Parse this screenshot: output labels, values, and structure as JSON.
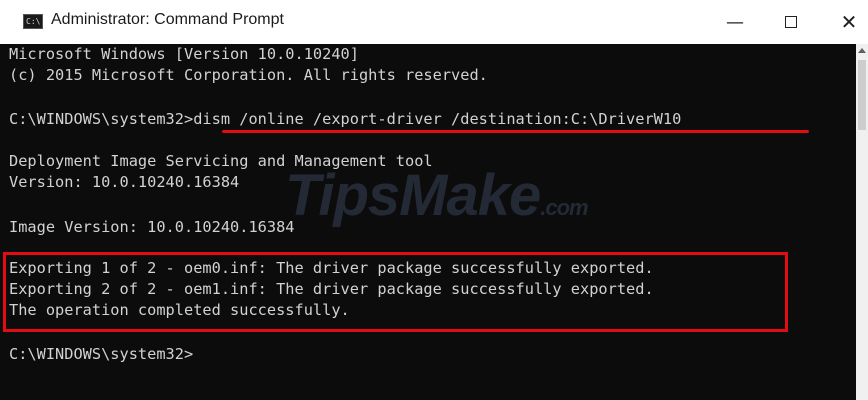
{
  "window": {
    "title": "Administrator: Command Prompt",
    "icon_label": "C:\\",
    "controls": {
      "minimize": "—",
      "close": "✕"
    }
  },
  "console": {
    "lines": [
      "Microsoft Windows [Version 10.0.10240]",
      "(c) 2015 Microsoft Corporation. All rights reserved.",
      "C:\\WINDOWS\\system32>dism /online /export-driver /destination:C:\\DriverW10",
      "Deployment Image Servicing and Management tool",
      "Version: 10.0.10240.16384",
      "Image Version: 10.0.10240.16384",
      "Exporting 1 of 2 - oem0.inf: The driver package successfully exported.",
      "Exporting 2 of 2 - oem1.inf: The driver package successfully exported.",
      "The operation completed successfully.",
      "C:\\WINDOWS\\system32>"
    ],
    "text_color": "#d2d2d2",
    "background_color": "#0c0c0c",
    "annotation_color": "#e10d12"
  },
  "watermark": {
    "text": "TipsMake",
    "suffix": ".com"
  },
  "icons": {
    "app": "cmd-icon",
    "minimize": "minimize-icon",
    "maximize": "maximize-icon",
    "close": "close-icon"
  }
}
